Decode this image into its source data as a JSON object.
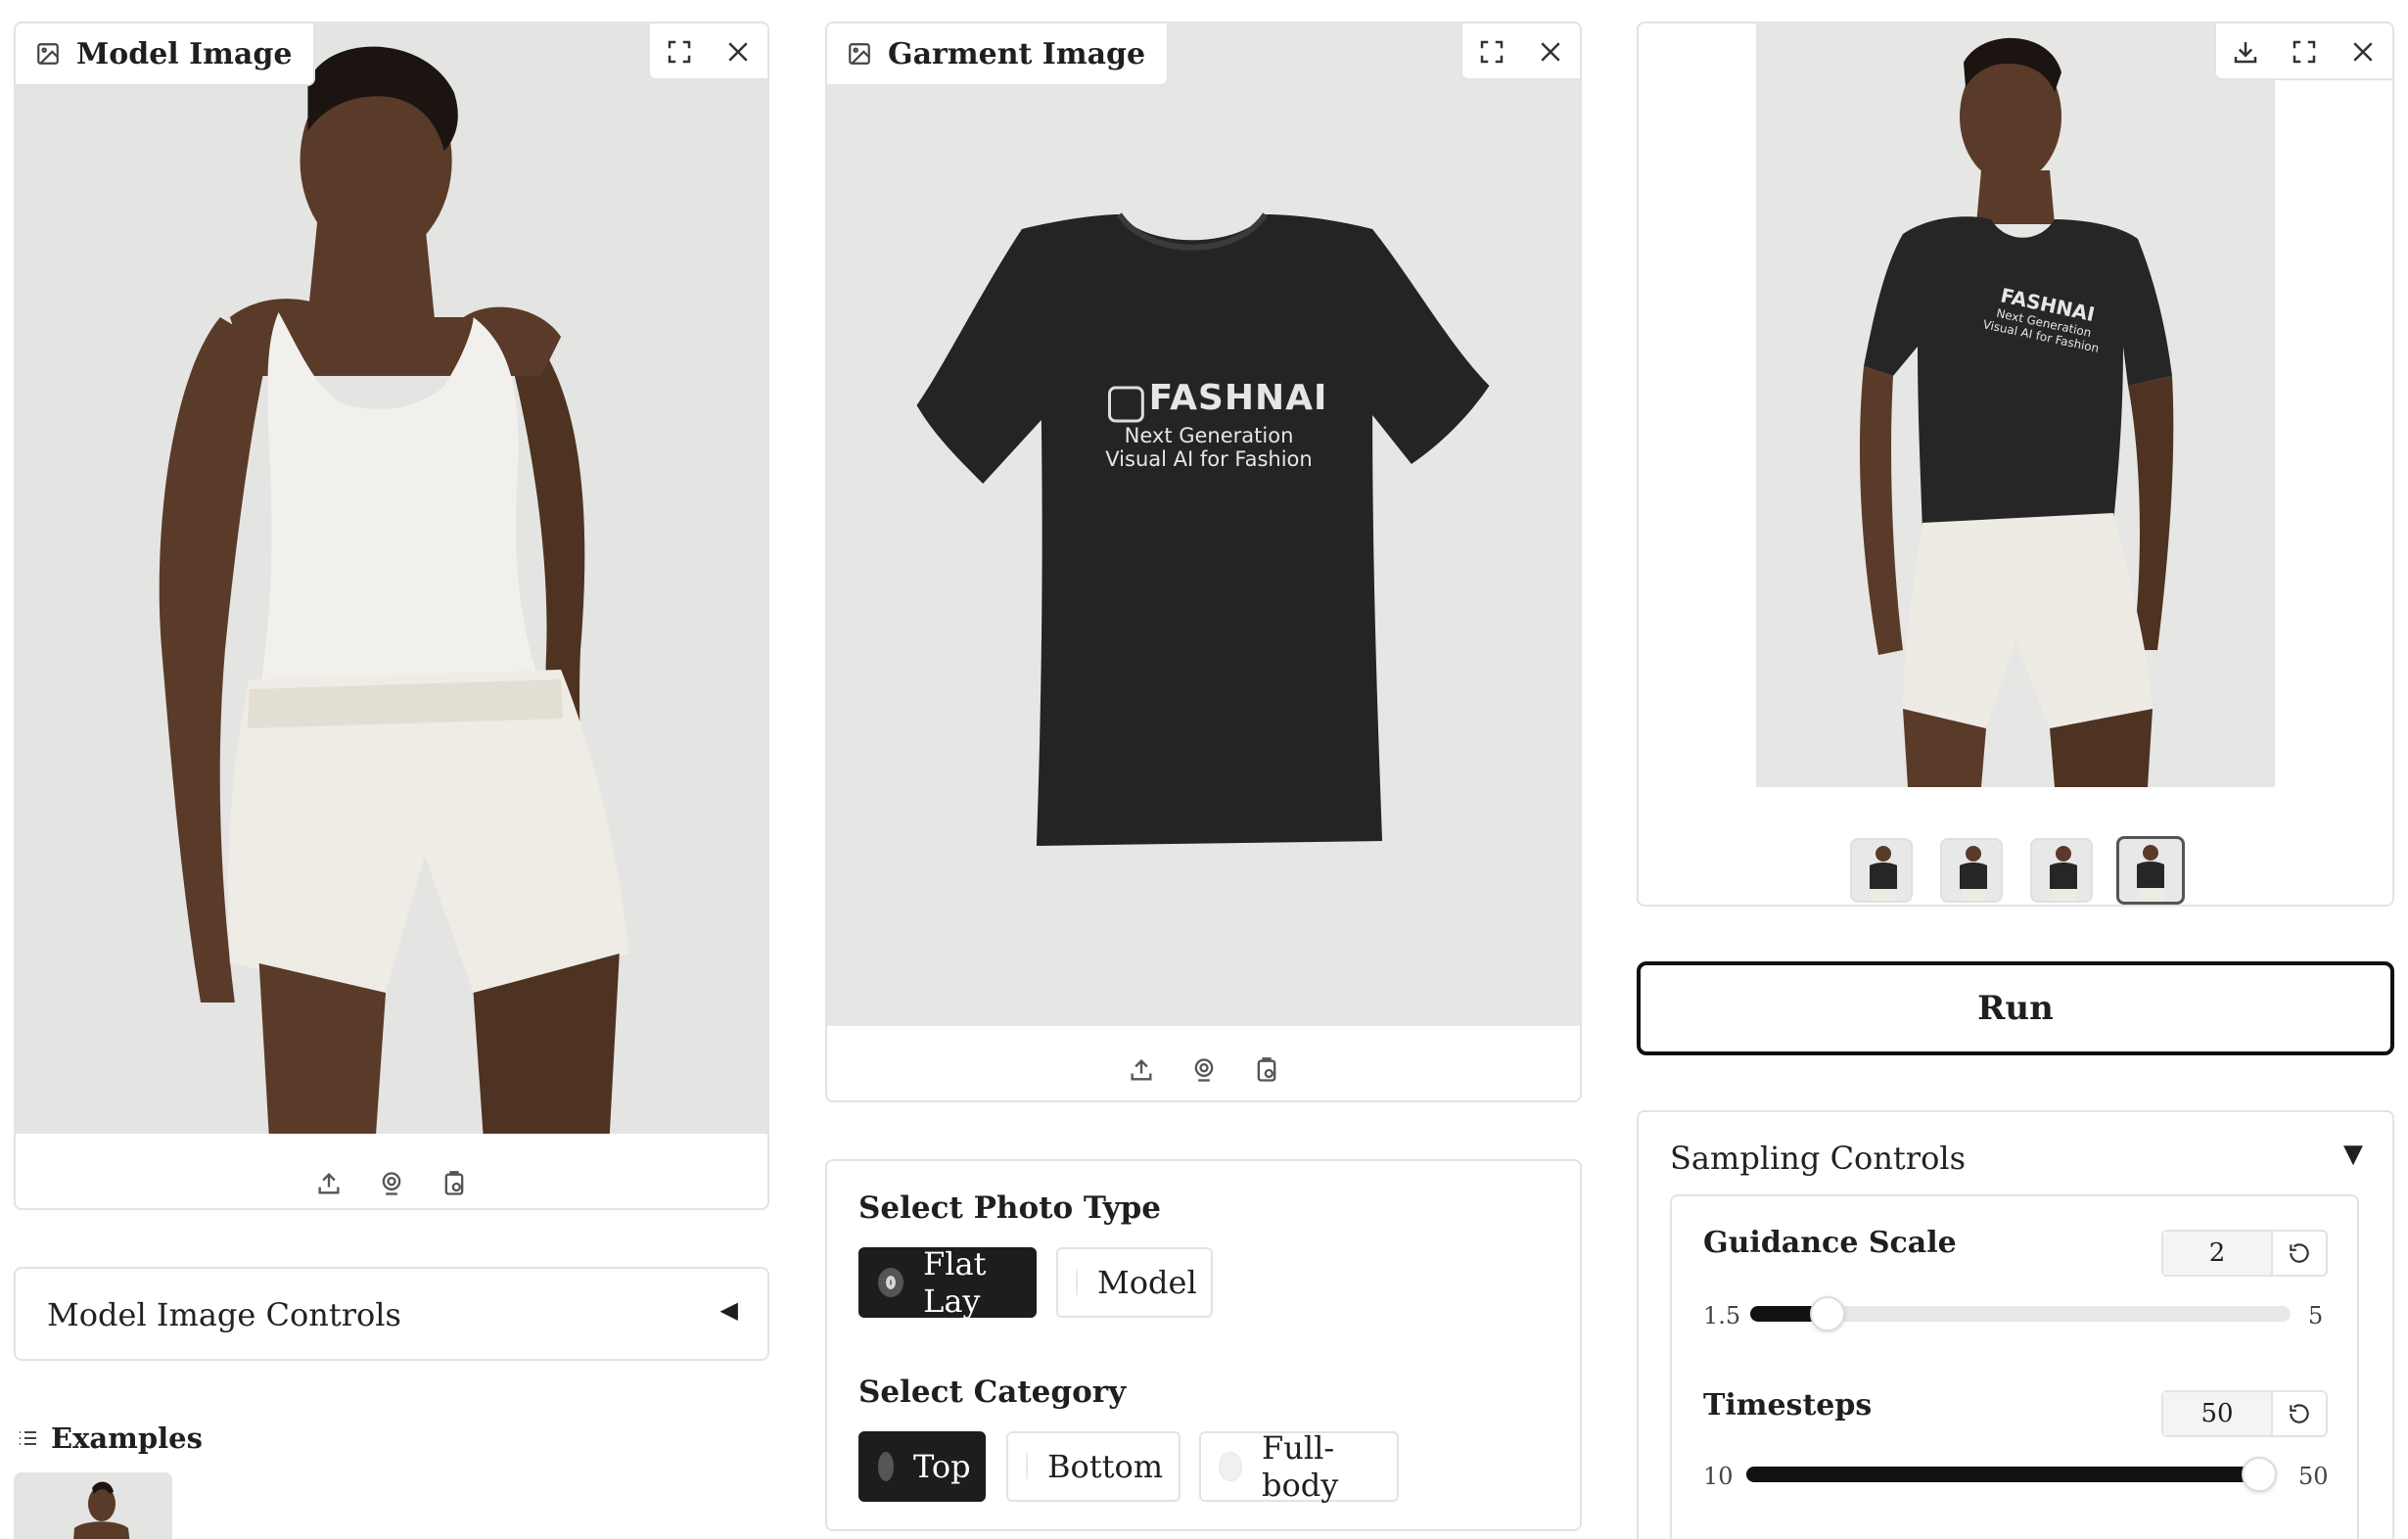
{
  "model_panel": {
    "label": "Model Image",
    "icons": [
      "image-icon",
      "fullscreen-icon",
      "close-icon",
      "upload-icon",
      "webcam-icon",
      "clipboard-icon"
    ]
  },
  "garment_panel": {
    "label": "Garment Image",
    "shirt_brand": "FASHNAI",
    "shirt_line1": "Next Generation",
    "shirt_line2": "Visual AI for Fashion"
  },
  "output_panel": {
    "icons": [
      "download-icon",
      "fullscreen-icon",
      "close-icon"
    ],
    "thumbnails_count": 4,
    "selected_thumbnail": 4
  },
  "model_controls": {
    "title": "Model Image Controls",
    "arrow": "◀"
  },
  "examples": {
    "title": "Examples"
  },
  "photo_type": {
    "title": "Select Photo Type",
    "options": [
      "Flat Lay",
      "Model"
    ],
    "selected": "Flat Lay"
  },
  "category": {
    "title": "Select Category",
    "options": [
      "Top",
      "Bottom",
      "Full-body"
    ],
    "selected": "Top"
  },
  "run_button": {
    "label": "Run"
  },
  "sampling": {
    "title": "Sampling Controls",
    "arrow": "▼",
    "guidance": {
      "label": "Guidance Scale",
      "value": "2",
      "min": "1.5",
      "max": "5",
      "fraction": 0.143
    },
    "timesteps": {
      "label": "Timesteps",
      "value": "50",
      "min": "10",
      "max": "50",
      "fraction": 1.0
    }
  },
  "colors": {
    "accent": "#1d1d1d",
    "border": "#e3e3e3",
    "image_bg": "#e6e6e6"
  }
}
